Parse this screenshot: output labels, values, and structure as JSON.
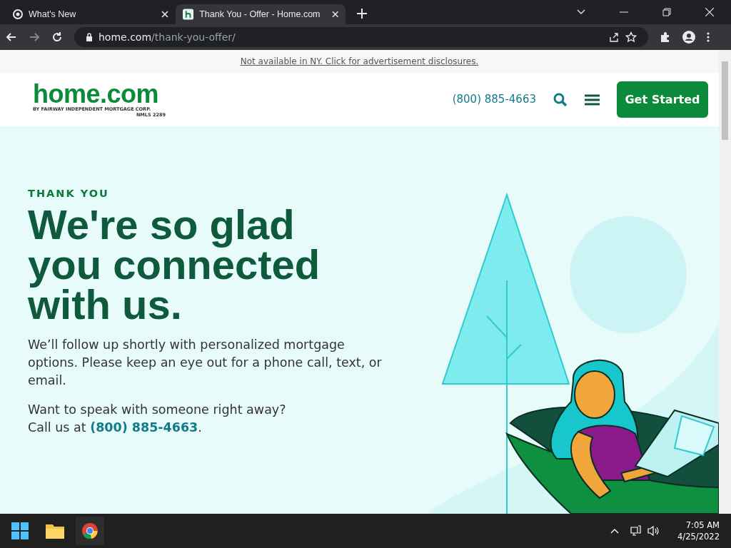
{
  "browser": {
    "tabs": [
      {
        "title": "What's New",
        "selected": false
      },
      {
        "title": "Thank You - Offer - Home.com",
        "selected": true
      }
    ],
    "url": {
      "domain": "home.com",
      "path": "/thank-you-offer/"
    }
  },
  "disclosure": "Not available in NY. Click for advertisement disclosures.",
  "header": {
    "logo": {
      "wordmark": "home.com",
      "tagline": "BY FAIRWAY INDEPENDENT MORTGAGE CORP.",
      "nmls": "NMLS 2289"
    },
    "phone": "(800) 885-4663",
    "button": "Get Started"
  },
  "hero": {
    "eyebrow": "THANK YOU",
    "heading": "We're so glad you connected with us.",
    "body": "We’ll follow up shortly with personalized mortgage options. Please keep an eye out for a phone call, text, or email.",
    "cta_question": "Want to speak with someone right away?",
    "cta_prefix": "Call us at ",
    "cta_phone": "(800) 885-4663",
    "cta_suffix": "."
  },
  "taskbar": {
    "time": "7:05 AM",
    "date": "4/25/2022"
  }
}
